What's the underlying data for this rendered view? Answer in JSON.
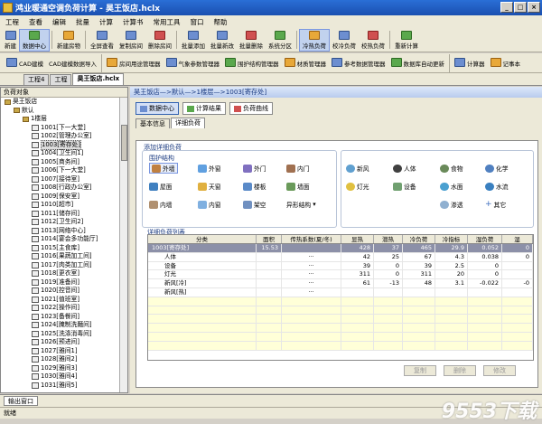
{
  "window": {
    "title": "鸿业暖通空调负荷计算 - 昊王饭店.hclx",
    "min": "_",
    "max": "□",
    "close": "×"
  },
  "menu": [
    "工程",
    "查看",
    "编辑",
    "批量",
    "计算",
    "计算书",
    "常用工具",
    "窗口",
    "帮助"
  ],
  "toolbar1": [
    "新建",
    "数据中心",
    "新建房物",
    "全屏查看",
    "复制房间",
    "删除房间",
    "批量添加",
    "批量新改",
    "批量删除",
    "系统分区",
    "冷热负荷",
    "校冷负荷",
    "校热负荷",
    "重新计算"
  ],
  "toolbar2": [
    "CAD建模",
    "CAD建模数据导入",
    "房间用途管理器",
    "气象参数管理器",
    "围护结构管理器",
    "材质管理器",
    "参考数据管理器",
    "数据库自动更新",
    "计算器",
    "记事本"
  ],
  "doctabs": [
    "工程4",
    "工程",
    "昊王饭店.hclx"
  ],
  "left": {
    "title": "负荷对象",
    "tree": [
      {
        "l": 0,
        "t": "昊王饭店",
        "i": "folder"
      },
      {
        "l": 1,
        "t": "默认",
        "i": "folder"
      },
      {
        "l": 2,
        "t": "1楼层",
        "i": "folder"
      },
      {
        "l": 3,
        "t": "1001[下一大堂]",
        "i": "room"
      },
      {
        "l": 3,
        "t": "1002[管理办公室]",
        "i": "room"
      },
      {
        "l": 3,
        "t": "1003[寄存处]",
        "i": "room",
        "sel": true
      },
      {
        "l": 3,
        "t": "1004[卫生间1]",
        "i": "room"
      },
      {
        "l": 3,
        "t": "1005[商务间]",
        "i": "room"
      },
      {
        "l": 3,
        "t": "1006[下一大堂]",
        "i": "room"
      },
      {
        "l": 3,
        "t": "1007[接待室]",
        "i": "room"
      },
      {
        "l": 3,
        "t": "1008[行政办公室]",
        "i": "room"
      },
      {
        "l": 3,
        "t": "1009[保安室]",
        "i": "room"
      },
      {
        "l": 3,
        "t": "1010[超市]",
        "i": "room"
      },
      {
        "l": 3,
        "t": "1011[储存间]",
        "i": "room"
      },
      {
        "l": 3,
        "t": "1012[卫生间2]",
        "i": "room"
      },
      {
        "l": 3,
        "t": "1013[网络中心]",
        "i": "room"
      },
      {
        "l": 3,
        "t": "1014[宴会多功能厅]",
        "i": "room"
      },
      {
        "l": 3,
        "t": "1015[主食库]",
        "i": "room"
      },
      {
        "l": 3,
        "t": "1016[果蔬加工间]",
        "i": "room"
      },
      {
        "l": 3,
        "t": "1017[肉类加工间]",
        "i": "room"
      },
      {
        "l": 3,
        "t": "1018[更衣室]",
        "i": "room"
      },
      {
        "l": 3,
        "t": "1019[准备间]",
        "i": "room"
      },
      {
        "l": 3,
        "t": "1020[控音间]",
        "i": "room"
      },
      {
        "l": 3,
        "t": "1021[值班室]",
        "i": "room"
      },
      {
        "l": 3,
        "t": "1022[操作间]",
        "i": "room"
      },
      {
        "l": 3,
        "t": "1023[备餐间]",
        "i": "room"
      },
      {
        "l": 3,
        "t": "1024[腌制洗麵间]",
        "i": "room"
      },
      {
        "l": 3,
        "t": "1025[洗涤消毒间]",
        "i": "room"
      },
      {
        "l": 3,
        "t": "1026[预进间]",
        "i": "room"
      },
      {
        "l": 3,
        "t": "1027[雅间1]",
        "i": "room"
      },
      {
        "l": 3,
        "t": "1028[雅间2]",
        "i": "room"
      },
      {
        "l": 3,
        "t": "1029[雅间3]",
        "i": "room"
      },
      {
        "l": 3,
        "t": "1030[雅间4]",
        "i": "room"
      },
      {
        "l": 3,
        "t": "1031[雅间5]",
        "i": "room"
      }
    ]
  },
  "breadcrumb": "昊王饭店—>默认—>1楼层—>1003[寄存处]",
  "subtabs": [
    "数据中心",
    "计算结果",
    "负荷曲线"
  ],
  "subtabs2": [
    "基本信息",
    "详细负荷"
  ],
  "detail": {
    "add_title": "添加详细负荷",
    "struct_title": "围护结构",
    "struct_btns": [
      "外墙",
      "外窗",
      "外门",
      "内门",
      "屋面",
      "天窗",
      "楼板",
      "墙面",
      "内墙",
      "内窗",
      "架空",
      "异形结构"
    ],
    "other_btns": [
      "新风",
      "人体",
      "食物",
      "化学",
      "灯光",
      "设备",
      "水面",
      "水流",
      "渗透",
      "其它"
    ],
    "list_title": "详细负荷列表",
    "columns": [
      "分类",
      "面积",
      "传热系数(夏/冬)",
      "显热",
      "潜热",
      "冷负荷",
      "冷指标",
      "湿负荷",
      "湿"
    ],
    "rows": [
      {
        "name": "1003[寄存处]",
        "area": "15.53",
        "coef": "",
        "sens": "428",
        "lat": "37",
        "cool": "465",
        "idx": "29.9",
        "wet": "0.052",
        "w2": "0",
        "sel": true
      },
      {
        "name": "人体",
        "area": "",
        "coef": "···",
        "sens": "42",
        "lat": "25",
        "cool": "67",
        "idx": "4.3",
        "wet": "0.038",
        "w2": "0"
      },
      {
        "name": "设备",
        "area": "",
        "coef": "···",
        "sens": "39",
        "lat": "0",
        "cool": "39",
        "idx": "2.5",
        "wet": "0",
        "w2": ""
      },
      {
        "name": "灯光",
        "area": "",
        "coef": "···",
        "sens": "311",
        "lat": "0",
        "cool": "311",
        "idx": "20",
        "wet": "0",
        "w2": ""
      },
      {
        "name": "新风[冷]",
        "area": "",
        "coef": "···",
        "sens": "61",
        "lat": "-13",
        "cool": "48",
        "idx": "3.1",
        "wet": "-0.022",
        "w2": "-0"
      },
      {
        "name": "新风[热]",
        "area": "",
        "coef": "···",
        "sens": "",
        "lat": "",
        "cool": "",
        "idx": "",
        "wet": "",
        "w2": ""
      }
    ],
    "buttons": [
      "复制",
      "删除",
      "修改"
    ]
  },
  "output_tab": "输出窗口",
  "status": "就绪",
  "watermark": "9553下载"
}
